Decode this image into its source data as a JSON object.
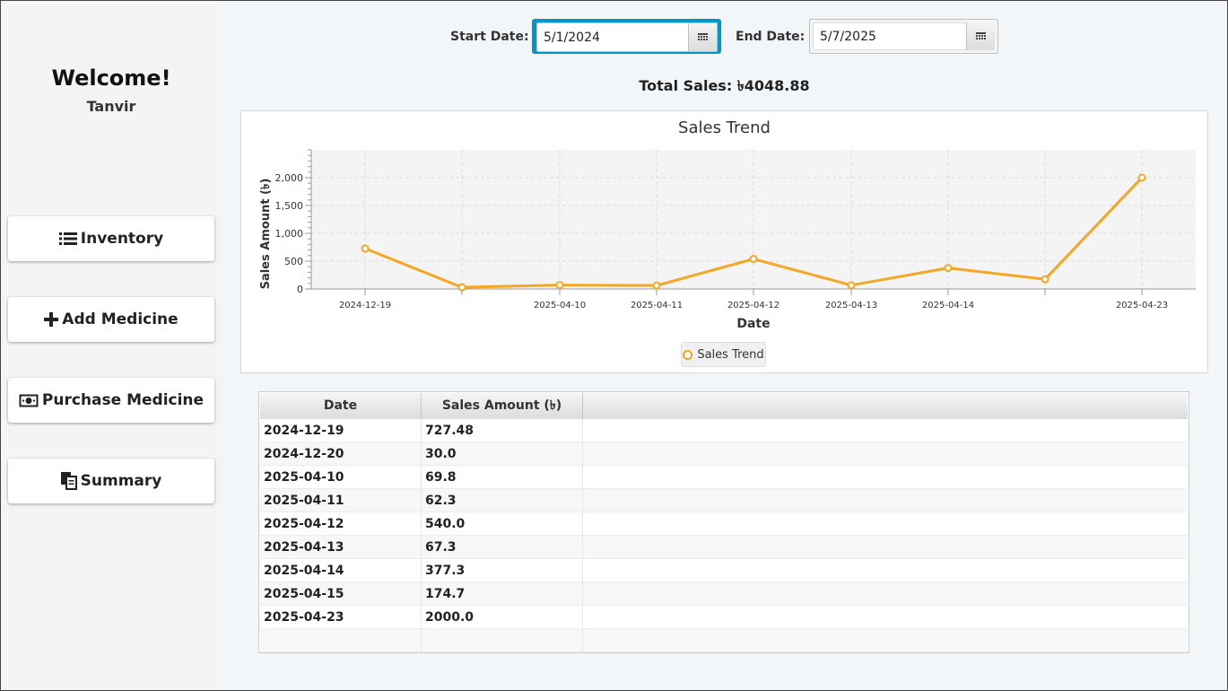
{
  "sidebar": {
    "welcome": "Welcome!",
    "username": "Tanvir",
    "items": [
      {
        "label": "Inventory",
        "icon": "list-icon"
      },
      {
        "label": "Add Medicine",
        "icon": "plus-icon"
      },
      {
        "label": "Purchase Medicine",
        "icon": "money-icon"
      },
      {
        "label": "Summary",
        "icon": "document-icon"
      }
    ]
  },
  "filters": {
    "start_label": "Start Date:",
    "start_value": "5/1/2024",
    "end_label": "End Date:",
    "end_value": "5/7/2025"
  },
  "total_sales": "Total Sales: ৳4048.88",
  "chart_data": {
    "type": "line",
    "title": "Sales Trend",
    "xlabel": "Date",
    "ylabel": "Sales Amount (৳)",
    "x": [
      "2024-12-19",
      "2024-12-20",
      "2025-04-10",
      "2025-04-11",
      "2025-04-12",
      "2025-04-13",
      "2025-04-14",
      "2025-04-15",
      "2025-04-23"
    ],
    "x_tick_labels": [
      "2024-12-19",
      "",
      "2025-04-10",
      "2025-04-11",
      "2025-04-12",
      "2025-04-13",
      "2025-04-14",
      "",
      "2025-04-23"
    ],
    "series": [
      {
        "name": "Sales Trend",
        "values": [
          727.48,
          30.0,
          69.8,
          62.3,
          540.0,
          67.3,
          377.3,
          174.7,
          2000.0
        ],
        "color": "#f5a623"
      }
    ],
    "y_ticks": [
      0,
      500,
      1000,
      1500,
      2000
    ],
    "y_tick_labels": [
      "0",
      "500",
      "1,000",
      "1,500",
      "2,000"
    ],
    "ylim": [
      0,
      2500
    ],
    "grid": true,
    "legend": "bottom-center"
  },
  "table": {
    "headers": [
      "Date",
      "Sales Amount (৳)",
      ""
    ],
    "rows": [
      [
        "2024-12-19",
        "727.48"
      ],
      [
        "2024-12-20",
        "30.0"
      ],
      [
        "2025-04-10",
        "69.8"
      ],
      [
        "2025-04-11",
        "62.3"
      ],
      [
        "2025-04-12",
        "540.0"
      ],
      [
        "2025-04-13",
        "67.3"
      ],
      [
        "2025-04-14",
        "377.3"
      ],
      [
        "2025-04-15",
        "174.7"
      ],
      [
        "2025-04-23",
        "2000.0"
      ]
    ]
  }
}
